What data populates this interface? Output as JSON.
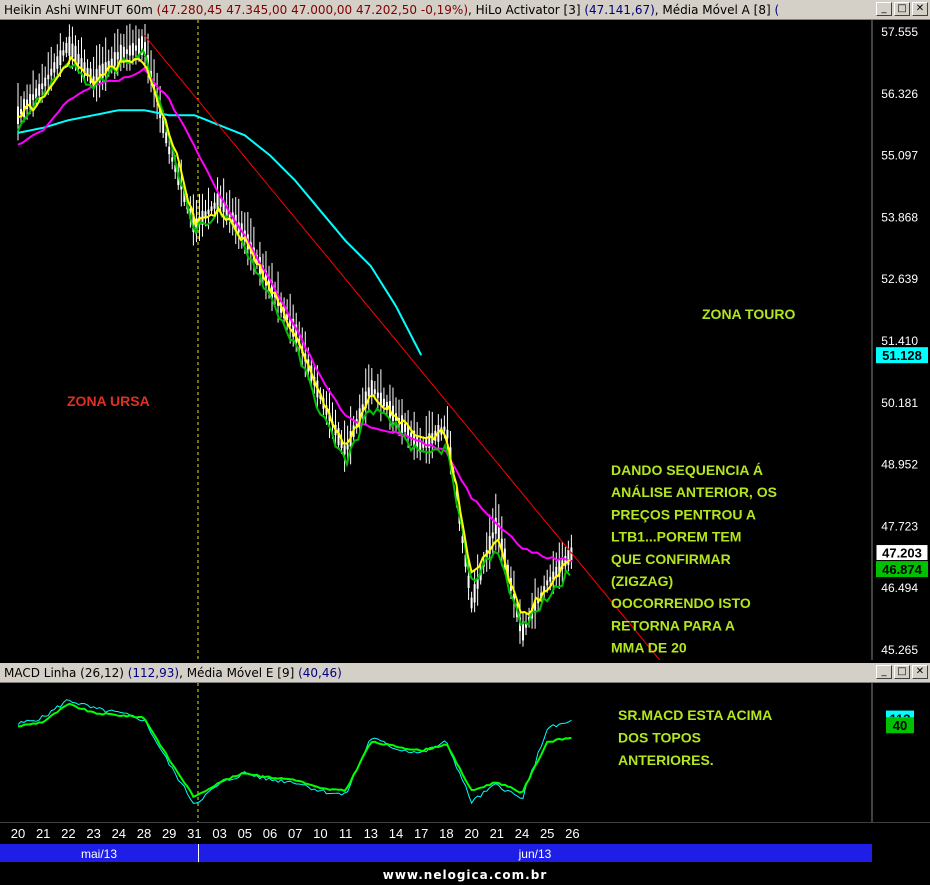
{
  "price_panel": {
    "title_name": "Heikin Ashi WINFUT 60m",
    "title_ohlc": "(47.280,45  47.345,00  47.000,00  47.202,50  -0,19%)",
    "title_hilo": ", HiLo Activator [3] ",
    "title_hilo_val": "(47.141,67)",
    "title_mma": ", Média Móvel A [8] ",
    "title_mma_val": "(",
    "y_ticks": [
      "57.555",
      "56.326",
      "55.097",
      "53.868",
      "52.639",
      "51.410",
      "50.181",
      "48.952",
      "47.723",
      "46.494",
      "45.265"
    ],
    "badges": [
      {
        "text": "51.128",
        "bg": "#00ffff",
        "fg": "#000000"
      },
      {
        "text": "47.203",
        "bg": "#ffffff",
        "fg": "#000000"
      },
      {
        "text": "46.874",
        "bg": "#00c000",
        "fg": "#000000"
      }
    ],
    "annotations": {
      "zona_touro": "ZONA TOURO",
      "zona_ursa": "ZONA URSA",
      "analysis": [
        "DANDO SEQUENCIA Á",
        "ANÁLISE ANTERIOR, OS",
        "PREÇOS PENTROU A",
        "LTB1...POREM TEM",
        "QUE CONFIRMAR",
        "(ZIGZAG)",
        "OOCORRENDO ISTO",
        "RETORNA PARA A",
        "MMA DE 20"
      ]
    }
  },
  "macd_panel": {
    "title_name": "MACD Linha (26,12) ",
    "title_macd_val": "(112,93)",
    "title_mme": ", Média Móvel E [9] ",
    "title_mme_val": "(40,46)",
    "badges": [
      {
        "text": "113",
        "bg": "#00ffff",
        "fg": "#000000"
      },
      {
        "text": "40",
        "bg": "#00c000",
        "fg": "#000000"
      }
    ],
    "annotation": [
      "SR.MACD ESTA ACIMA",
      "DOS TOPOS",
      "ANTERIORES."
    ]
  },
  "x_axis": {
    "days": [
      "20",
      "21",
      "22",
      "23",
      "24",
      "28",
      "29",
      "31",
      "03",
      "05",
      "06",
      "07",
      "10",
      "11",
      "13",
      "14",
      "17",
      "18",
      "20",
      "21",
      "24",
      "25",
      "26"
    ],
    "months": [
      "mai/13",
      "jun/13"
    ]
  },
  "footer": "www.nelogica.com.br",
  "colors": {
    "hilo": "#00c000",
    "mma8": "#ffff00",
    "mma20": "#ff00ff",
    "mma200": "#00ffff",
    "trendline": "#ff0000",
    "annotation_green": "#b4e61e",
    "annotation_red": "#e03020",
    "macd_line": "#00ffff",
    "macd_signal": "#00ff00"
  },
  "chart_data": [
    {
      "type": "line",
      "title": "Heikin Ashi WINFUT 60m",
      "x": [
        "20",
        "21",
        "22",
        "23",
        "24",
        "28",
        "29",
        "31",
        "03",
        "05",
        "06",
        "07",
        "10",
        "11",
        "13",
        "14",
        "17",
        "18",
        "20",
        "21",
        "24",
        "25",
        "26"
      ],
      "ylim": [
        45265,
        57555
      ],
      "series": [
        {
          "name": "Heikin Ashi WINFUT 60m",
          "values": [
            55900,
            56500,
            57300,
            56600,
            57100,
            57300,
            55200,
            53700,
            54200,
            53500,
            52500,
            51600,
            50300,
            49200,
            50500,
            49900,
            49300,
            49700,
            46200,
            47800,
            45600,
            46600,
            47203
          ]
        },
        {
          "name": "HiLo Activator [3]",
          "values": [
            55700,
            56300,
            57000,
            56400,
            56900,
            57100,
            55500,
            53600,
            54000,
            53300,
            52300,
            51300,
            50000,
            49000,
            50100,
            49700,
            49100,
            49300,
            46600,
            47300,
            45700,
            46300,
            46874
          ]
        },
        {
          "name": "Média Móvel A [8]",
          "values": [
            55900,
            56200,
            57000,
            56600,
            56900,
            57000,
            55600,
            53800,
            54000,
            53400,
            52500,
            51500,
            50300,
            49300,
            50300,
            49900,
            49400,
            49600,
            46800,
            47500,
            45900,
            46500,
            47141
          ]
        },
        {
          "values": [
            55300,
            55600,
            56200,
            56500,
            56600,
            56800,
            56200,
            55300,
            54300,
            53500,
            52600,
            51700,
            50700,
            49900,
            49700,
            49600,
            49400,
            49200,
            48300,
            47800,
            47300,
            47100,
            47050
          ]
        },
        {
          "values": [
            55550,
            55650,
            55800,
            55900,
            56000,
            56000,
            55900,
            55900,
            55700,
            55500,
            55100,
            54600,
            54000,
            53400,
            52900,
            52100,
            51128
          ]
        }
      ]
    },
    {
      "type": "line",
      "title": "MACD Linha (26,12)",
      "x": [
        "20",
        "21",
        "22",
        "23",
        "24",
        "28",
        "29",
        "31",
        "03",
        "05",
        "06",
        "07",
        "10",
        "11",
        "13",
        "14",
        "17",
        "18",
        "20",
        "21",
        "24",
        "25",
        "26"
      ],
      "series": [
        {
          "name": "MACD Linha (26,12)",
          "values": [
            100,
            130,
            210,
            170,
            150,
            120,
            -80,
            -260,
            -170,
            -120,
            -150,
            -160,
            -200,
            -220,
            40,
            -10,
            -30,
            20,
            -250,
            -170,
            -240,
            80,
            113
          ]
        },
        {
          "name": "Média Móvel E [9]",
          "values": [
            90,
            110,
            190,
            150,
            140,
            130,
            -60,
            -230,
            -160,
            -120,
            -140,
            -150,
            -190,
            -200,
            20,
            0,
            -20,
            10,
            -200,
            -160,
            -210,
            20,
            40
          ]
        }
      ]
    }
  ]
}
